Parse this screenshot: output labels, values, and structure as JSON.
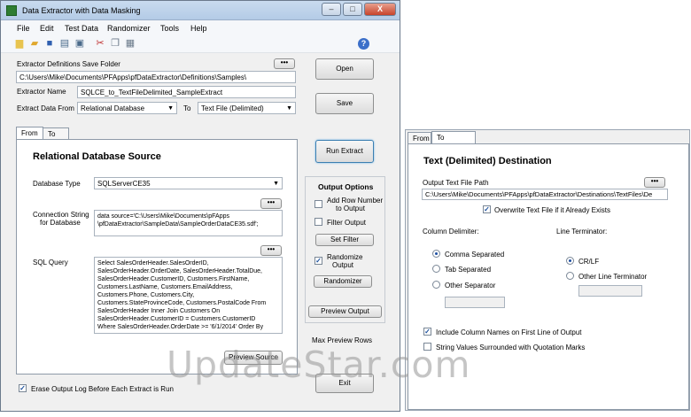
{
  "window": {
    "title": "Data Extractor with Data Masking",
    "controls": [
      "–",
      "□",
      "X"
    ]
  },
  "menu": [
    "File",
    "Edit",
    "Test Data",
    "Randomizer",
    "Tools",
    "Help"
  ],
  "toolbar_icons": [
    "new-icon",
    "open-folder-icon",
    "save-icon",
    "print-icon",
    "print-preview-icon",
    "cut-icon",
    "copy-icon",
    "paste-icon"
  ],
  "help_label": "?",
  "top": {
    "save_folder_label": "Extractor Definitions Save Folder",
    "save_folder_value": "C:\\Users\\Mike\\Documents\\PFApps\\pfDataExtractor\\Definitions\\Samples\\",
    "dots": "•••",
    "extractor_name_label": "Extractor Name",
    "extractor_name_value": "SQLCE_to_TextFileDelimited_SampleExtract",
    "extract_from_label": "Extract Data From",
    "extract_from_value": "Relational Database",
    "to_label": "To",
    "extract_to_value": "Text File (Delimited)",
    "open_btn": "Open",
    "save_btn": "Save",
    "run_btn": "Run Extract"
  },
  "tabs": [
    "From",
    "To"
  ],
  "source": {
    "heading": "Relational Database Source",
    "db_type_label": "Database Type",
    "db_type_value": "SQLServerCE35",
    "conn_label_1": "Connection String",
    "conn_label_2": "for Database",
    "conn_lines": [
      "data source='C:\\Users\\Mike\\Documents\\pFApps",
      "\\pfDataExtractor\\SampleData\\SampleOrderDataCE35.sdf';"
    ],
    "sql_label": "SQL Query",
    "sql_lines": [
      "Select  SalesOrderHeader.SalesOrderID,",
      "SalesOrderHeader.OrderDate, SalesOrderHeader.TotalDue,",
      "SalesOrderHeader.CustomerID, Customers.FirstName,",
      "Customers.LastName, Customers.EmailAddress,",
      "Customers.Phone, Customers.City,",
      "Customers.StateProvinceCode, Customers.PostalCode From",
      "SalesOrderHeader Inner Join Customers On",
      "SalesOrderHeader.CustomerID = Customers.CustomerID",
      "Where SalesOrderHeader.OrderDate >= '6/1/2014' Order By"
    ],
    "preview_source_btn": "Preview Source"
  },
  "output_options": {
    "title": "Output Options",
    "add_row_number_1": "Add Row Number",
    "add_row_number_2": "to Output",
    "filter_output": "Filter Output",
    "set_filter_btn": "Set Filter",
    "randomize_1": "Randomize",
    "randomize_2": "Output",
    "randomizer_btn": "Randomizer",
    "preview_output_btn": "Preview Output"
  },
  "max_preview_label": "Max Preview Rows",
  "exit_btn": "Exit",
  "erase_log_label": "Erase Output Log Before Each Extract is Run",
  "check_mark": "✓",
  "dest": {
    "heading": "Text (Delimited) Destination",
    "path_label": "Output Text File Path",
    "path_value": "C:\\Users\\Mike\\Documents\\PFApps\\pfDataExtractor\\Destinations\\TextFiles\\De",
    "overwrite_label": "Overwrite Text File if it Already Exists",
    "col_delim_label": "Column Delimiter:",
    "line_term_label": "Line Terminator:",
    "comma": "Comma Separated",
    "tab": "Tab Separated",
    "other_sep": "Other Separator",
    "crlf": "CR/LF",
    "other_line": "Other Line Terminator",
    "include_names": "Include Column Names on First Line of Output",
    "string_quotes": "String Values Surrounded with Quotation Marks"
  },
  "watermark": "UpdateStar.com"
}
